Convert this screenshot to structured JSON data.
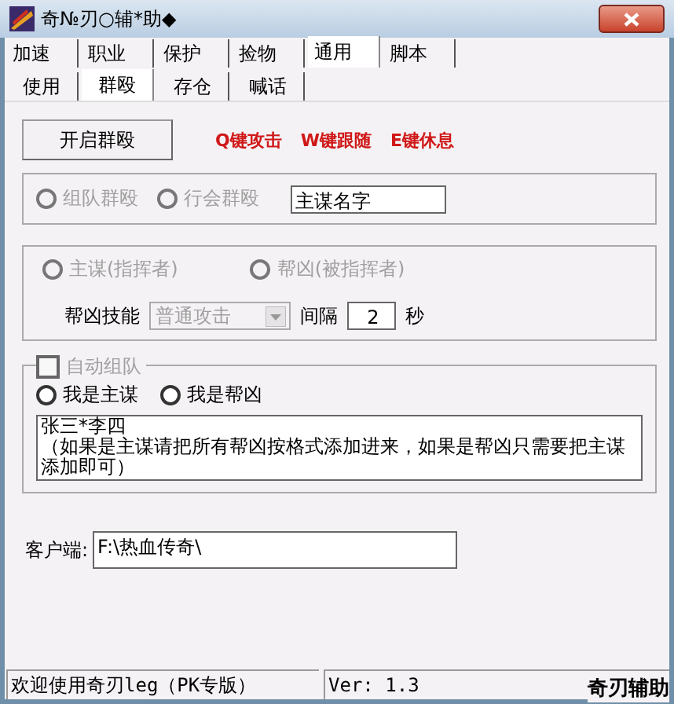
{
  "window": {
    "title": "奇№刃○辅*助◆"
  },
  "tabs": [
    {
      "label": "加速",
      "selected": false
    },
    {
      "label": "职业",
      "selected": false
    },
    {
      "label": "保护",
      "selected": false
    },
    {
      "label": "捡物",
      "selected": false
    },
    {
      "label": "通用",
      "selected": true
    },
    {
      "label": "脚本",
      "selected": false
    }
  ],
  "subtabs": [
    {
      "label": "使用",
      "selected": false
    },
    {
      "label": "群殴",
      "selected": true
    },
    {
      "label": "存仓",
      "selected": false
    },
    {
      "label": "喊话",
      "selected": false
    }
  ],
  "start_button": "开启群殴",
  "hotkeys": [
    "Q键攻击",
    "W键跟随",
    "E键休息"
  ],
  "mode_group": {
    "radios": [
      {
        "label": "组队群殴",
        "selected": false,
        "disabled": true
      },
      {
        "label": "行会群殴",
        "selected": false,
        "disabled": true
      }
    ],
    "leader_name": "主谋名字"
  },
  "role_group": {
    "radios": [
      {
        "label": "主谋(指挥者)",
        "selected": false,
        "disabled": true
      },
      {
        "label": "帮凶(被指挥者)",
        "selected": false,
        "disabled": true
      }
    ],
    "skill_label": "帮凶技能",
    "skill": {
      "value": "普通攻击",
      "disabled": true
    },
    "interval_label": "间隔",
    "interval": "2",
    "unit": "秒"
  },
  "team_group": {
    "auto_team": {
      "label": "自动组队",
      "checked": false,
      "disabled": true
    },
    "radios": [
      {
        "label": "我是主谋",
        "selected": false,
        "disabled": false
      },
      {
        "label": "我是帮凶",
        "selected": false,
        "disabled": false
      }
    ],
    "members": [
      "张三*李四",
      "（如果是主谋请把所有帮凶按格式添加进来，如果是帮凶只需要把主谋添加即可）"
    ]
  },
  "client": {
    "label": "客户端:",
    "value": "F:\\热血传奇\\"
  },
  "status_bar": [
    "欢迎使用奇刃leg（PK专版）",
    "Ver: 1.3"
  ],
  "brand": "奇刃辅助"
}
